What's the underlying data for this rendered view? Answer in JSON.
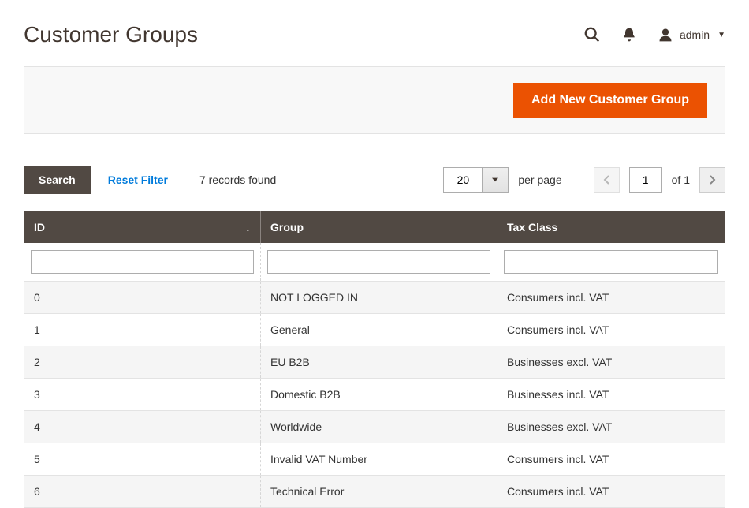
{
  "header": {
    "title": "Customer Groups",
    "account": "admin"
  },
  "toolbar": {
    "add_button": "Add New Customer Group"
  },
  "controls": {
    "search": "Search",
    "reset": "Reset Filter",
    "records": "7 records found",
    "perpage_value": "20",
    "perpage_label": "per page",
    "page_value": "1",
    "page_of": "of 1"
  },
  "table": {
    "columns": {
      "id": "ID",
      "group": "Group",
      "tax_class": "Tax Class"
    },
    "rows": [
      {
        "id": "0",
        "group": "NOT LOGGED IN",
        "tax_class": "Consumers incl. VAT"
      },
      {
        "id": "1",
        "group": "General",
        "tax_class": "Consumers incl. VAT"
      },
      {
        "id": "2",
        "group": "EU B2B",
        "tax_class": "Businesses excl. VAT"
      },
      {
        "id": "3",
        "group": "Domestic B2B",
        "tax_class": "Businesses incl. VAT"
      },
      {
        "id": "4",
        "group": "Worldwide",
        "tax_class": "Businesses excl. VAT"
      },
      {
        "id": "5",
        "group": "Invalid VAT Number",
        "tax_class": "Consumers incl. VAT"
      },
      {
        "id": "6",
        "group": "Technical Error",
        "tax_class": "Consumers incl. VAT"
      }
    ]
  }
}
